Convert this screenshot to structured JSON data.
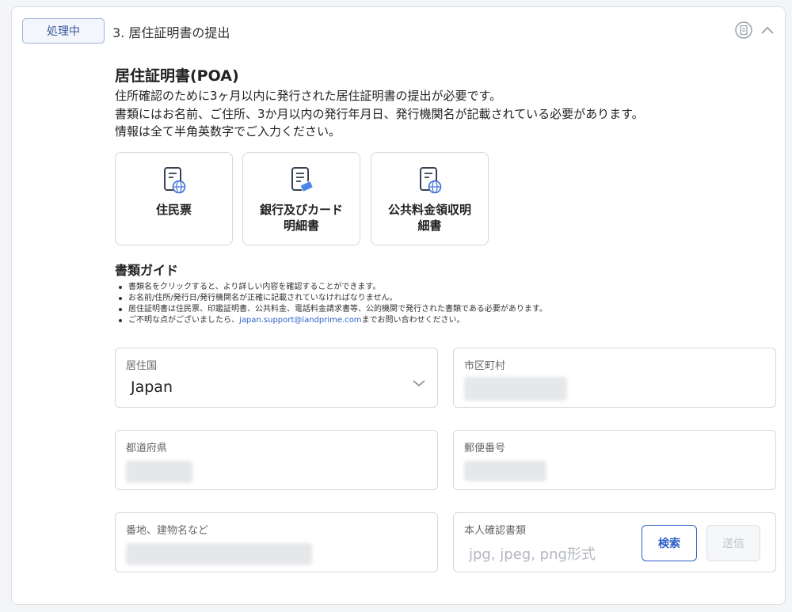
{
  "header": {
    "status": "処理中",
    "step_title": "3. 居住証明書の提出"
  },
  "section": {
    "title": "居住証明書(POA)",
    "description": [
      "住所確認のために3ヶ月以内に発行された居住証明書の提出が必要です。",
      "書類にはお名前、ご住所、3か月以内の発行年月日、発行機関名が記載されている必要があります。",
      "情報は全て半角英数字でご入力ください。"
    ]
  },
  "documents": [
    {
      "label": "住民票",
      "icon": "document-globe-icon"
    },
    {
      "label": "銀行及びカード\n明細書",
      "icon": "document-card-icon"
    },
    {
      "label": "公共料金領収明\n細書",
      "icon": "document-globe-icon"
    }
  ],
  "guide": {
    "title": "書類ガイド",
    "items": [
      "書類名をクリックすると、より詳しい内容を確認することができます。",
      "お名前/住所/発行日/発行機関名が正確に記載されていなければなりません。",
      "居住証明書は住民票、印鑑証明書、公共料金、電話料金請求書等、公的機関で発行された書類である必要があります。"
    ],
    "contact_prefix": "ご不明な点がございましたら、",
    "contact_email": "japan.support@landprime.com",
    "contact_suffix": "までお問い合わせください。"
  },
  "form": {
    "country_label": "居住国",
    "country_value": "Japan",
    "city_label": "市区町村",
    "prefecture_label": "都道府県",
    "postal_label": "郵便番号",
    "address_label": "番地、建物名など",
    "id_doc_label": "本人確認書類",
    "id_doc_placeholder": "jpg, jpeg, png形式",
    "search_button": "検索",
    "send_button": "送信"
  },
  "colors": {
    "accent": "#2e5fc9",
    "badge_bg": "#f3f6fc",
    "border": "#d5d8de"
  }
}
